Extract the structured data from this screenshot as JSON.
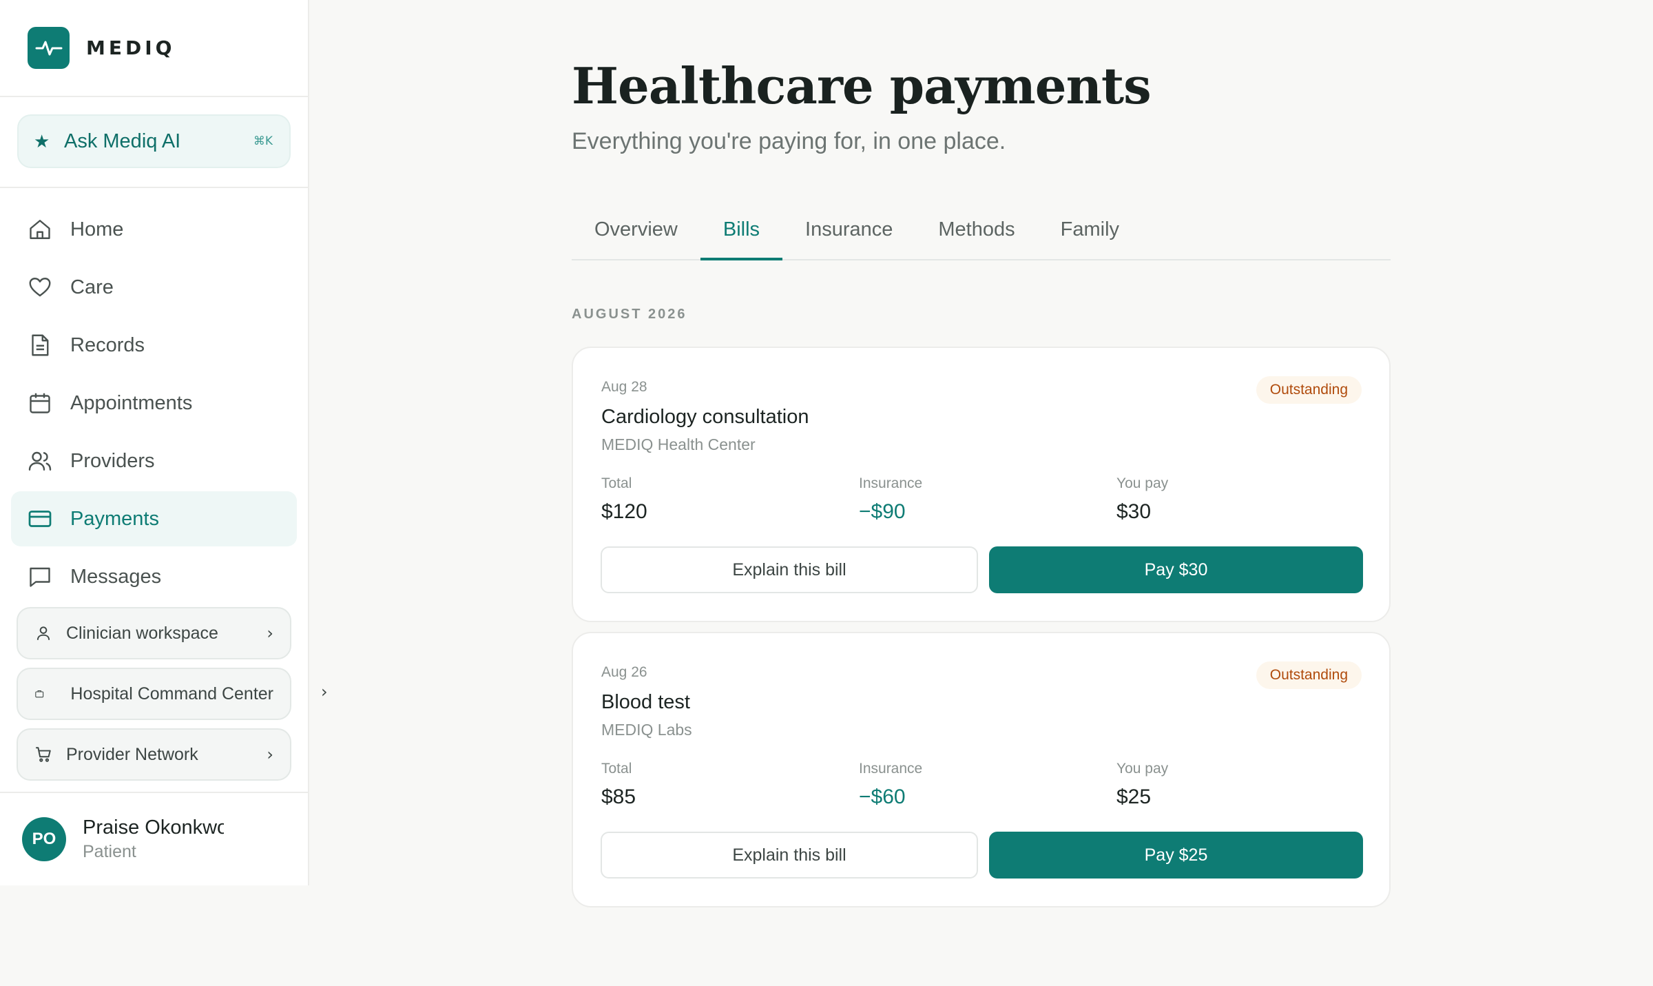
{
  "brand": {
    "name": "MEDIQ"
  },
  "ask": {
    "label": "Ask Mediq AI",
    "shortcut": "⌘K"
  },
  "nav": [
    {
      "label": "Home",
      "icon": "home-icon"
    },
    {
      "label": "Care",
      "icon": "heart-icon"
    },
    {
      "label": "Records",
      "icon": "document-icon"
    },
    {
      "label": "Appointments",
      "icon": "calendar-icon"
    },
    {
      "label": "Providers",
      "icon": "users-icon"
    },
    {
      "label": "Payments",
      "icon": "credit-card-icon",
      "active": true
    },
    {
      "label": "Messages",
      "icon": "message-icon"
    }
  ],
  "workspaces": [
    {
      "label": "Clinician workspace",
      "icon": "person-icon"
    },
    {
      "label": "Hospital Command Center",
      "icon": "briefcase-icon"
    },
    {
      "label": "Provider Network",
      "icon": "cart-icon"
    }
  ],
  "user": {
    "initials": "PO",
    "name": "Praise Okonkwo",
    "role": "Patient"
  },
  "page": {
    "title": "Healthcare payments",
    "subtitle": "Everything you're paying for, in one place."
  },
  "tabs": [
    "Overview",
    "Bills",
    "Insurance",
    "Methods",
    "Family"
  ],
  "active_tab": "Bills",
  "month": "AUGUST 2026",
  "bills": [
    {
      "date": "Aug 28",
      "title": "Cardiology consultation",
      "provider": "MEDIQ Health Center",
      "status": "Outstanding",
      "total_label": "Total",
      "total": "$120",
      "insurance_label": "Insurance",
      "insurance": "−$90",
      "you_pay_label": "You pay",
      "you_pay": "$30",
      "explain_label": "Explain this bill",
      "pay_label": "Pay $30"
    },
    {
      "date": "Aug 26",
      "title": "Blood test",
      "provider": "MEDIQ Labs",
      "status": "Outstanding",
      "total_label": "Total",
      "total": "$85",
      "insurance_label": "Insurance",
      "insurance": "−$60",
      "you_pay_label": "You pay",
      "you_pay": "$25",
      "explain_label": "Explain this bill",
      "pay_label": "Pay $25"
    }
  ],
  "colors": {
    "accent": "#0e7c74",
    "badge_text": "#b04b0c",
    "badge_bg": "#fdf6ec"
  }
}
